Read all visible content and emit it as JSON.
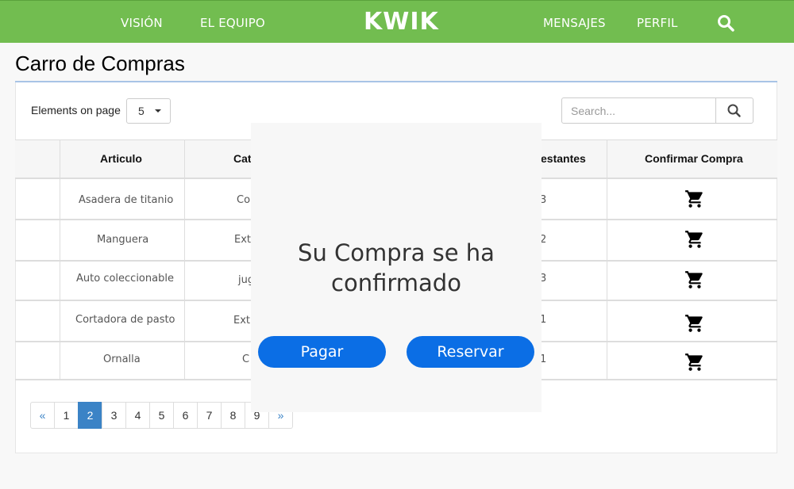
{
  "nav": {
    "vision": "VISIÓN",
    "equipo": "EL EQUIPO",
    "brand": "KWIK",
    "mensajes": "MENSAJES",
    "perfil": "PERFIL",
    "search_icon": "search-icon"
  },
  "page": {
    "title": "Carro de Compras"
  },
  "controls": {
    "elements_label": "Elements on page",
    "elements_value": "5",
    "search_placeholder": "Search..."
  },
  "table": {
    "headers": {
      "articulo": "Articulo",
      "categoria": "Cat",
      "restantes": "estantes",
      "confirmar": "Confirmar Compra"
    },
    "rows": [
      {
        "articulo": "Asadera de titanio",
        "categoria": "Co",
        "restantes": "3"
      },
      {
        "articulo": "Manguera",
        "categoria": "Ext",
        "restantes": "2"
      },
      {
        "articulo": "Auto coleccionable",
        "categoria": "jug",
        "restantes": "3"
      },
      {
        "articulo": "Cortadora de pasto",
        "categoria": "Ext",
        "restantes": "1"
      },
      {
        "articulo": "Ornalla",
        "categoria": "C",
        "restantes": "1"
      }
    ],
    "row_icon": "shopping-cart-icon"
  },
  "pagination": {
    "prev": "«",
    "pages": [
      "1",
      "2",
      "3",
      "4",
      "5",
      "6",
      "7",
      "8",
      "9"
    ],
    "current": "2",
    "next": "»"
  },
  "modal": {
    "message": "Su Compra se ha confirmado",
    "pagar": "Pagar",
    "reservar": "Reservar"
  },
  "colors": {
    "navbar": "#72bd50",
    "active_page": "#3b83c6",
    "modal_button": "#0b6ee5"
  }
}
